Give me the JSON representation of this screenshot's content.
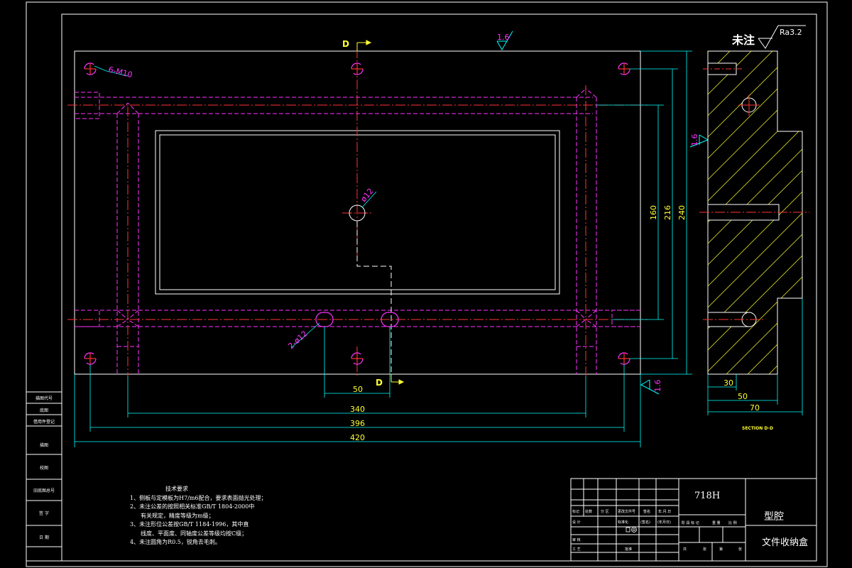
{
  "drawing": {
    "section_marker": "D",
    "section_title": "SECTION D-D",
    "surface_note_label": "未注",
    "surface_roughness": "Ra3.2",
    "roughness_marks": [
      "1.6",
      "1.6",
      "1.6"
    ],
    "hole_callouts": {
      "tapped": "6-M10",
      "center_hole": "ø12",
      "side_holes": "2-ø12"
    },
    "dimensions": {
      "bottom": [
        "50",
        "340",
        "396",
        "420"
      ],
      "right": [
        "160",
        "216",
        "240"
      ],
      "section": [
        "30",
        "50",
        "70"
      ]
    }
  },
  "side_labels": [
    "描图代号",
    "底图",
    "借用件登记",
    "描图",
    "校图",
    "旧底图总号",
    "签 字",
    "日 期"
  ],
  "tech_requirements": {
    "title": "技术要求",
    "items": [
      "1、侧板与定模板为H7/m6配合，要求表面抛光处理；",
      "2、未注公差的按照相关标准GB/T 1804-2000中",
      "有关规定，精度等级为m级；",
      "3、未注形位公差按GB/T 1184-1996，其中直",
      "线度、平面度、同轴度公差等级均按C级；",
      "4、未注圆角为R0.5，锐角去毛刺。"
    ]
  },
  "title_block": {
    "material": "718H",
    "part_name": "型腔",
    "assembly_name": "文件收纳盒",
    "header_labels": [
      "标记",
      "处数",
      "分 区",
      "更改文件号",
      "签名",
      "年.月.日"
    ],
    "row_labels": [
      "设 计",
      "审 核",
      "工 艺"
    ],
    "std_label": "标准化",
    "approve_label": "批准",
    "sign_date": "(签名)",
    "year_date": "(年月日)",
    "stage_labels": [
      "阶 段 标 记",
      "重 量",
      "比 例"
    ],
    "sheet_labels": [
      "共",
      "张",
      "第",
      "张"
    ]
  }
}
